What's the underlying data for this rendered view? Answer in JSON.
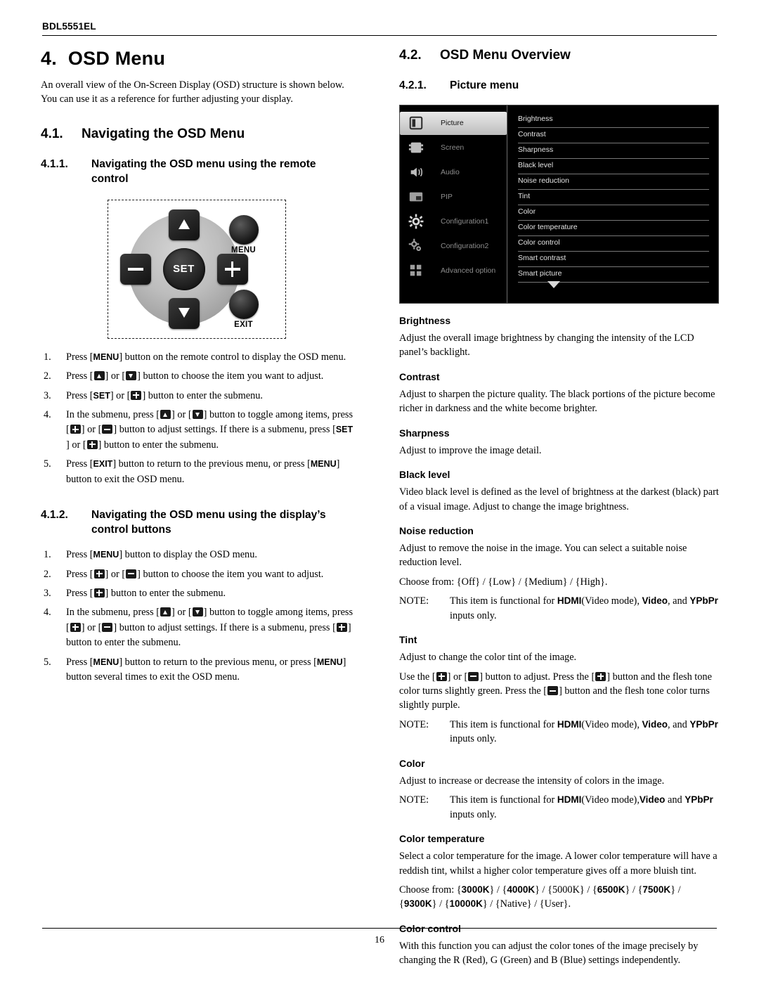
{
  "header": {
    "model": "BDL5551EL"
  },
  "footer": {
    "page": "16"
  },
  "left": {
    "chapter_num": "4.",
    "chapter_title": "OSD Menu",
    "intro": "An overall view of the On-Screen Display (OSD) structure is shown below. You can use it as a reference for further adjusting your display.",
    "sec1_num": "4.1.",
    "sec1_title": "Navigating  the OSD Menu",
    "sub1_num": "4.1.1.",
    "sub1_title": "Navigating the OSD menu using the remote control",
    "remote": {
      "set_label": "SET",
      "menu_label": "MENU",
      "exit_label": "EXIT",
      "up_icon": "triangle-up-icon",
      "down_icon": "triangle-down-icon",
      "plus_icon": "plus-icon",
      "minus_icon": "minus-icon"
    },
    "steps1": [
      {
        "n": "1.",
        "parts": [
          "Press [",
          "MENU",
          "] button on the remote control to display the OSD menu."
        ]
      },
      {
        "n": "2.",
        "parts": [
          "Press [",
          "UP",
          "] or [",
          "DOWN",
          "] button to choose the item you want to adjust."
        ]
      },
      {
        "n": "3.",
        "parts": [
          "Press [",
          "SET",
          "] or [",
          "PLUS",
          "] button to enter the submenu."
        ]
      },
      {
        "n": "4.",
        "parts": [
          "In the submenu, press [",
          "UP",
          "] or [",
          "DOWN",
          "] button to toggle among items, press [",
          "PLUS",
          "] or [",
          "MINUS",
          "] button to adjust settings. If there is a submenu, press [",
          "SET",
          "] or [",
          "PLUS",
          "] button to enter the submenu."
        ]
      },
      {
        "n": "5.",
        "parts": [
          "Press [",
          "EXIT",
          "] button to return to the previous menu, or press [",
          "MENU",
          "] button to exit the OSD menu."
        ]
      }
    ],
    "sub2_num": "4.1.2.",
    "sub2_title": "Navigating the OSD menu using the display’s control buttons",
    "steps2": [
      {
        "n": "1.",
        "parts": [
          "Press [",
          "MENU",
          "] button to display the OSD menu."
        ]
      },
      {
        "n": "2.",
        "parts": [
          "Press [",
          "PLUS",
          "] or [",
          "MINUS",
          "] button to choose the item you want to adjust."
        ]
      },
      {
        "n": "3.",
        "parts": [
          "Press [",
          "PLUS",
          "] button to enter the submenu."
        ]
      },
      {
        "n": "4.",
        "parts": [
          "In the submenu, press [",
          "UP",
          "] or [",
          "DOWN",
          "] button to toggle among items, press [",
          "PLUS",
          "] or [",
          "MINUS",
          "] button to adjust settings. If there is a submenu, press [",
          "PLUS",
          "] button to enter the submenu."
        ]
      },
      {
        "n": "5.",
        "parts": [
          "Press [",
          "MENU",
          "] button to return to the previous menu, or press [",
          "MENU",
          "] button several times to exit the OSD menu."
        ]
      }
    ]
  },
  "right": {
    "sec_num": "4.2.",
    "sec_title": "OSD Menu Overview",
    "sub_num": "4.2.1.",
    "sub_title": "Picture menu",
    "osd": {
      "categories": [
        {
          "label": "Picture",
          "icon": "picture-icon",
          "selected": true
        },
        {
          "label": "Screen",
          "icon": "screen-icon",
          "selected": false
        },
        {
          "label": "Audio",
          "icon": "audio-icon",
          "selected": false
        },
        {
          "label": "PIP",
          "icon": "pip-icon",
          "selected": false
        },
        {
          "label": "Configuration1",
          "icon": "configuration1-icon",
          "selected": false
        },
        {
          "label": "Configuration2",
          "icon": "configuration2-icon",
          "selected": false
        },
        {
          "label": "Advanced option",
          "icon": "advanced-option-icon",
          "selected": false
        }
      ],
      "items": [
        "Brightness",
        "Contrast",
        "Sharpness",
        "Black level",
        "Noise reduction",
        "Tint",
        "Color",
        "Color temperature",
        "Color control",
        "Smart contrast",
        "Smart picture"
      ],
      "scroll_icon": "triangle-down-icon"
    },
    "entries": [
      {
        "title": "Brightness",
        "paras": [
          "Adjust the overall image brightness by changing the intensity of the LCD panel’s backlight."
        ]
      },
      {
        "title": "Contrast",
        "paras": [
          "Adjust to sharpen the picture quality. The black portions of the picture become richer in darkness and the white become brighter."
        ]
      },
      {
        "title": "Sharpness",
        "paras": [
          "Adjust to improve the image detail."
        ]
      },
      {
        "title": "Black level",
        "paras": [
          "Video black level is defined as the level of brightness at the darkest (black) part of a visual image. Adjust to change the image brightness."
        ]
      },
      {
        "title": "Noise reduction",
        "paras": [
          "Adjust to remove the noise in the image. You can select a suitable noise reduction level.",
          "Choose from: {Off} / {Low} / {Medium} / {High}."
        ],
        "note": {
          "label": "NOTE:",
          "text_html": "This item is functional for <b>HDMI</b>(Video mode), <b>Video</b>, and <b>YPbPr</b> inputs only."
        }
      },
      {
        "title": "Tint",
        "paras": [
          "Adjust to change the color tint of the image.",
          "TINT_SPECIAL"
        ],
        "note": {
          "label": "NOTE:",
          "text_html": "This item is functional for <b>HDMI</b>(Video mode), <b>Video</b>, and <b>YPbPr</b> inputs only."
        }
      },
      {
        "title": "Color",
        "paras": [
          "Adjust to increase or decrease the intensity of colors in the image."
        ],
        "note": {
          "label": "NOTE:",
          "text_html": "This item is functional for <b>HDMI</b>(Video mode),<b>Video</b> and <b>YPbPr</b> inputs only."
        }
      },
      {
        "title": "Color temperature",
        "paras": [
          "Select a color temperature for the image. A lower color temperature will have a reddish tint, whilst a higher color temperature gives off a more bluish tint.",
          "CT_SPECIAL"
        ]
      },
      {
        "title": "Color control",
        "paras": [
          "With this function you can adjust the color tones of the image precisely by changing the R (Red), G (Green) and B (Blue) settings independently."
        ]
      }
    ],
    "tint_text_a": "Use the [",
    "tint_text_b": "] or [",
    "tint_text_c": "] button to adjust. Press the [",
    "tint_text_d": "] button and the flesh tone color turns slightly green. Press the [",
    "tint_text_e": "] button and the flesh tone color turns slightly purple.",
    "ct_prefix": "Choose from: {",
    "ct_values": [
      "3000K",
      "4000K",
      "5000K",
      "6500K",
      "7500K",
      "9300K",
      "10000K",
      "Native",
      "User"
    ]
  }
}
